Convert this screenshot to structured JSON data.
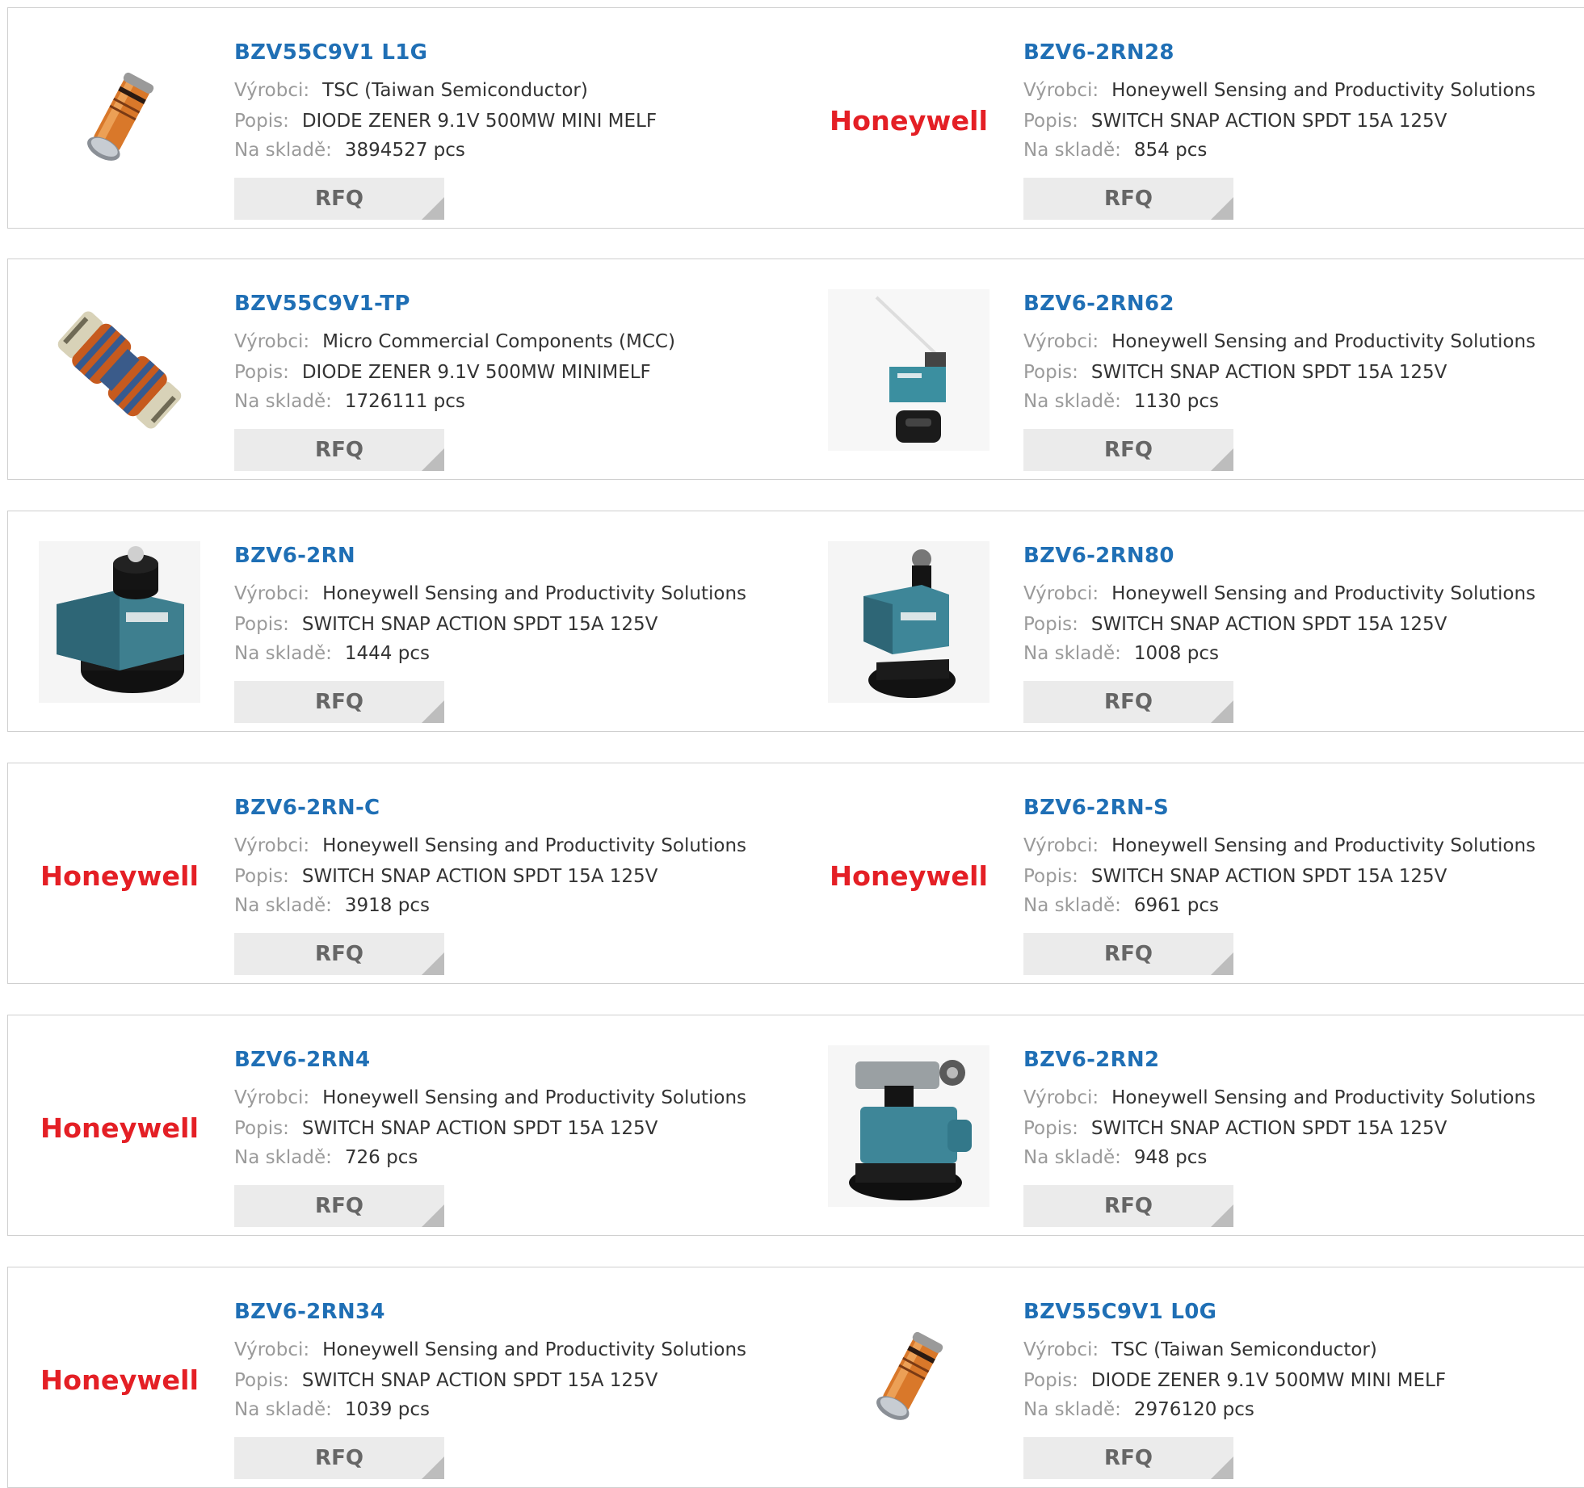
{
  "labels": {
    "manufacturer": "Výrobci:",
    "description": "Popis:",
    "stock": "Na skladě:",
    "rfq": "RFQ"
  },
  "colors": {
    "part_link": "#1f6fb5",
    "label": "#9a9a9a",
    "button_bg": "#ebebeb",
    "brand_logo": "#e41f25"
  },
  "products": [
    {
      "part": "BZV55C9V1 L1G",
      "manufacturer": "TSC (Taiwan Semiconductor)",
      "description": "DIODE ZENER 9.1V 500MW MINI MELF",
      "stock": "3894527 pcs",
      "image": "melf-diode-icon"
    },
    {
      "part": "BZV6-2RN28",
      "manufacturer": "Honeywell Sensing and Productivity Solutions",
      "description": "SWITCH SNAP ACTION SPDT 15A 125V",
      "stock": "854 pcs",
      "image": "honeywell-logo",
      "logo_text": "Honeywell"
    },
    {
      "part": "BZV55C9V1-TP",
      "manufacturer": "Micro Commercial Components (MCC)",
      "description": "DIODE ZENER 9.1V 500MW MINIMELF",
      "stock": "1726111 pcs",
      "image": "minimelf-diode-icon"
    },
    {
      "part": "BZV6-2RN62",
      "manufacturer": "Honeywell Sensing and Productivity Solutions",
      "description": "SWITCH SNAP ACTION SPDT 15A 125V",
      "stock": "1130 pcs",
      "image": "lever-switch-icon"
    },
    {
      "part": "BZV6-2RN",
      "manufacturer": "Honeywell Sensing and Productivity Solutions",
      "description": "SWITCH SNAP ACTION SPDT 15A 125V",
      "stock": "1444 pcs",
      "image": "plunger-switch-icon"
    },
    {
      "part": "BZV6-2RN80",
      "manufacturer": "Honeywell Sensing and Productivity Solutions",
      "description": "SWITCH SNAP ACTION SPDT 15A 125V",
      "stock": "1008 pcs",
      "image": "roller-plunger-switch-icon"
    },
    {
      "part": "BZV6-2RN-C",
      "manufacturer": "Honeywell Sensing and Productivity Solutions",
      "description": "SWITCH SNAP ACTION SPDT 15A 125V",
      "stock": "3918 pcs",
      "image": "honeywell-logo",
      "logo_text": "Honeywell"
    },
    {
      "part": "BZV6-2RN-S",
      "manufacturer": "Honeywell Sensing and Productivity Solutions",
      "description": "SWITCH SNAP ACTION SPDT 15A 125V",
      "stock": "6961 pcs",
      "image": "honeywell-logo",
      "logo_text": "Honeywell"
    },
    {
      "part": "BZV6-2RN4",
      "manufacturer": "Honeywell Sensing and Productivity Solutions",
      "description": "SWITCH SNAP ACTION SPDT 15A 125V",
      "stock": "726 pcs",
      "image": "honeywell-logo",
      "logo_text": "Honeywell"
    },
    {
      "part": "BZV6-2RN2",
      "manufacturer": "Honeywell Sensing and Productivity Solutions",
      "description": "SWITCH SNAP ACTION SPDT 15A 125V",
      "stock": "948 pcs",
      "image": "roller-lever-switch-icon"
    },
    {
      "part": "BZV6-2RN34",
      "manufacturer": "Honeywell Sensing and Productivity Solutions",
      "description": "SWITCH SNAP ACTION SPDT 15A 125V",
      "stock": "1039 pcs",
      "image": "honeywell-logo",
      "logo_text": "Honeywell"
    },
    {
      "part": "BZV55C9V1 L0G",
      "manufacturer": "TSC (Taiwan Semiconductor)",
      "description": "DIODE ZENER 9.1V 500MW MINI MELF",
      "stock": "2976120 pcs",
      "image": "melf-diode-icon"
    }
  ]
}
